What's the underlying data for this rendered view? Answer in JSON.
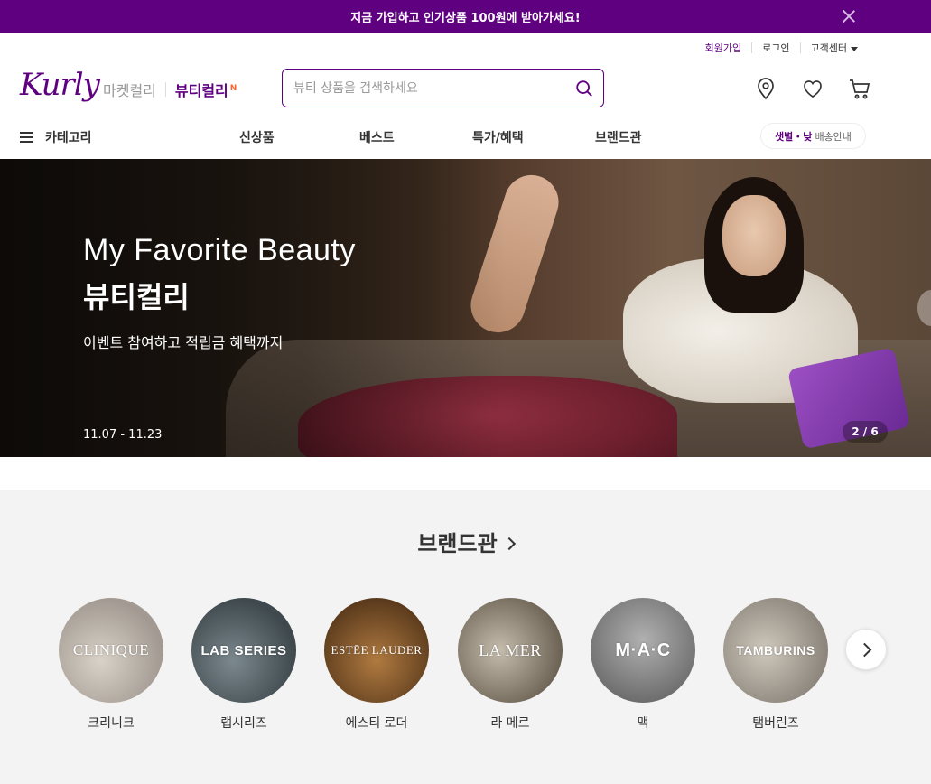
{
  "promo": {
    "text": "지금 가입하고 인기상품 100원에 받아가세요!"
  },
  "util_links": {
    "signup": "회원가입",
    "login": "로그인",
    "customer_center": "고객센터"
  },
  "logo": {
    "text": "Kurly"
  },
  "site_tabs": {
    "market": "마켓컬리",
    "beauty": "뷰티컬리",
    "new_badge": "N"
  },
  "search": {
    "placeholder": "뷰티 상품을 검색하세요",
    "value": ""
  },
  "gnb": {
    "category": "카테고리",
    "items": [
      "신상품",
      "베스트",
      "특가/혜택",
      "브랜드관"
    ],
    "delivery": {
      "accent": "샛별・낮",
      "rest": "배송안내"
    }
  },
  "hero": {
    "title": "My Favorite Beauty",
    "subtitle": "뷰티컬리",
    "description": "이벤트 참여하고 적립금 혜택까지",
    "date": "11.07 - 11.23",
    "page": "2 / 6"
  },
  "brands": {
    "title": "브랜드관",
    "items": [
      {
        "label": "크리니크",
        "logo": "CLINIQUE",
        "color": "#a29a92"
      },
      {
        "label": "랩시리즈",
        "logo": "LAB SERIES",
        "color": "#4f5a5f"
      },
      {
        "label": "에스티 로더",
        "logo": "ESTĒE LAUDER",
        "color": "#7a5530"
      },
      {
        "label": "라 메르",
        "logo": "LA MER",
        "color": "#7d7466"
      },
      {
        "label": "맥",
        "logo": "M·A·C",
        "color": "#8c8c8c"
      },
      {
        "label": "탬버린즈",
        "logo": "TAMBURINS",
        "color": "#9b948a"
      }
    ]
  }
}
